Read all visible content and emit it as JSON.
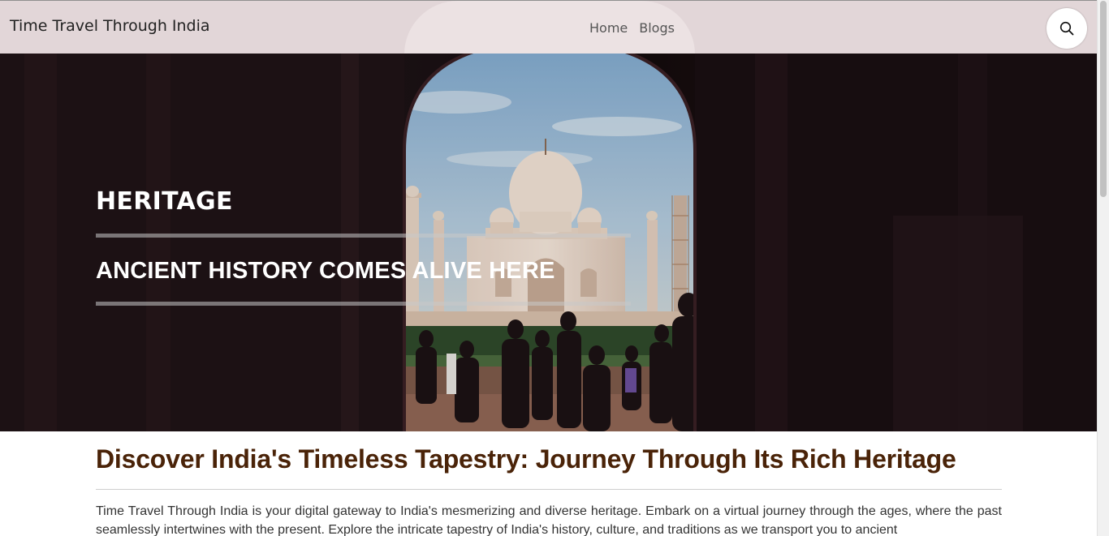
{
  "header": {
    "brand": "Time Travel Through India",
    "nav": [
      {
        "label": "Home"
      },
      {
        "label": "Blogs"
      }
    ],
    "search_icon": "search-icon"
  },
  "hero": {
    "title": "HERITAGE",
    "subtitle": "ANCIENT HISTORY COMES ALIVE HERE",
    "image": "taj-mahal-through-archway"
  },
  "main": {
    "heading": "Discover India's Timeless Tapestry: Journey Through Its Rich Heritage",
    "paragraph": "Time Travel Through India is your digital gateway to India's mesmerizing and diverse heritage. Embark on a virtual journey through the ages, where the past seamlessly intertwines with the present. Explore the intricate tapestry of India's history, culture, and traditions as we transport you to ancient"
  },
  "colors": {
    "header_bg": "#e2d6d8",
    "heading": "#4a2308",
    "hero_text": "#ffffff"
  }
}
